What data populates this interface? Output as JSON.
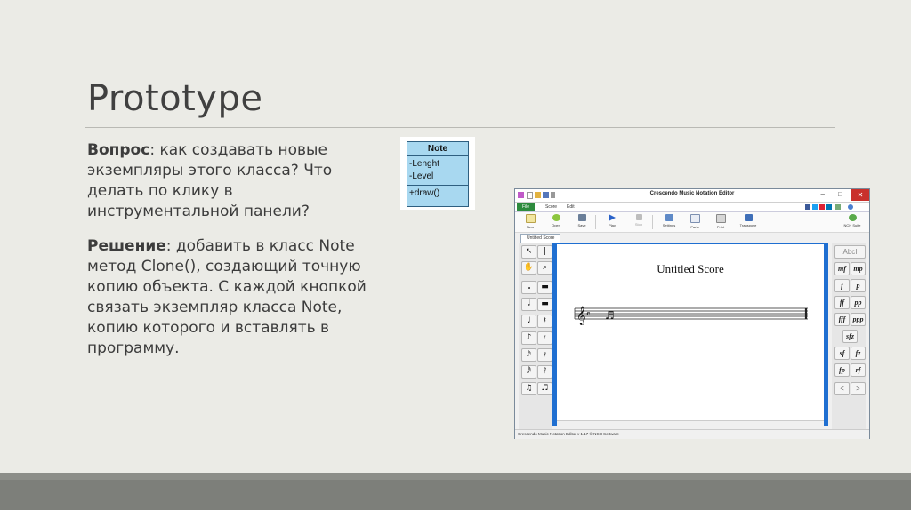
{
  "slide": {
    "title": "Prototype",
    "question_label": "Вопрос",
    "question_text": ": как создавать новые экземпляры этого класса? Что делать по клику в инструментальной панели?",
    "solution_label": "Решение",
    "solution_text": ": добавить в класс Note метод Clone(), создающий точную копию объекта. С каждой кнопкой связать экземпляр класса Note, копию которого и вставлять в программу."
  },
  "uml": {
    "class_name": "Note",
    "attributes": [
      "-Lenght",
      "-Level"
    ],
    "operations": [
      "+draw()"
    ]
  },
  "app": {
    "window_title": "Crescendo Music Notation Editor",
    "menu_tabs": [
      "File",
      "Score",
      "Edit"
    ],
    "toolbar": [
      "New",
      "Open",
      "Save",
      "Play",
      "Stop",
      "Settings",
      "Parts",
      "Print",
      "Transpose"
    ],
    "suite_label": "NCH Suite",
    "document_tab": "Untitled Score",
    "score_title": "Untitled Score",
    "status_text": "Crescendo Music Notation Editor v 1.17 © NCH Software",
    "dynamics": [
      "mf",
      "mp",
      "f",
      "p",
      "ff",
      "pp",
      "fff",
      "ppp",
      "sfz",
      "sf",
      "fz",
      "fp",
      "rf",
      "<",
      ">"
    ],
    "text_tool_label": "AbcI",
    "colors": {
      "file_tab": "#2e8b3e",
      "score_frame": "#1f6fd1",
      "close_button": "#c9302c"
    }
  }
}
